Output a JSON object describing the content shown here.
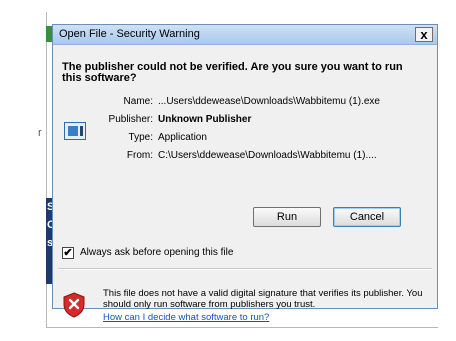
{
  "dialog": {
    "title": "Open File - Security Warning",
    "close_label": "x",
    "question": "The publisher could not be verified.  Are you sure you want to run this software?",
    "fields": [
      {
        "label": "Name:",
        "value": "...Users\\ddewease\\Downloads\\Wabbitemu (1).exe"
      },
      {
        "label": "Publisher:",
        "value": "Unknown Publisher"
      },
      {
        "label": "Type:",
        "value": "Application"
      },
      {
        "label": "From:",
        "value": "C:\\Users\\ddewease\\Downloads\\Wabbitemu (1)...."
      }
    ],
    "run_label": "Run",
    "cancel_label": "Cancel",
    "checkbox_mark": "✔",
    "checkbox_checked": true,
    "checkbox_label": "Always ask before opening this file",
    "warning_text": "This file does not have a valid digital signature that verifies its publisher.  You should only run software from publishers you trust.",
    "help_link": "How can I decide what software to run?"
  },
  "background": {
    "fragment_letter": "r",
    "strip_letters": [
      "S",
      "O",
      "s"
    ]
  },
  "colors": {
    "titlebar": "#bcd4f0",
    "dialog_bg": "#f0f0f0",
    "link": "#0b55c4",
    "shield_red": "#d42a2a"
  }
}
